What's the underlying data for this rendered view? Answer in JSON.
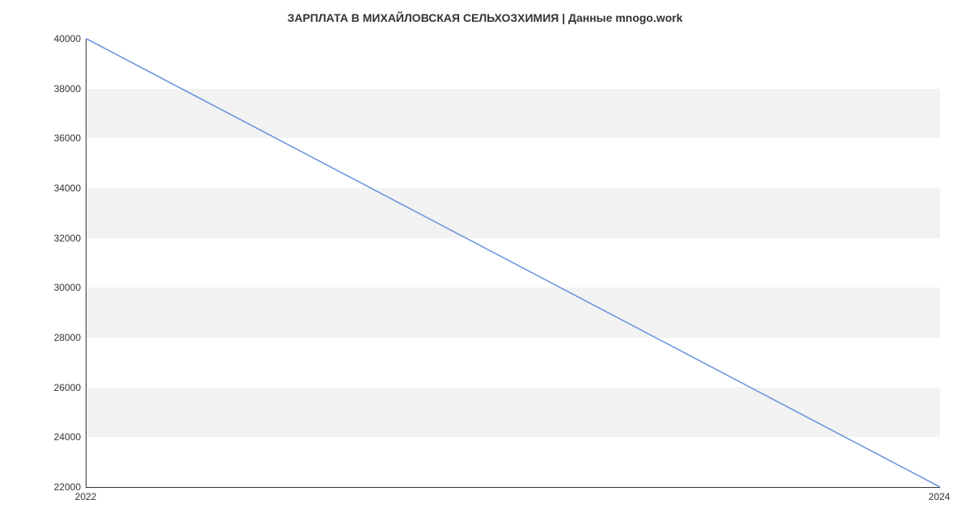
{
  "chart_data": {
    "type": "line",
    "title": "ЗАРПЛАТА В  МИХАЙЛОВСКАЯ СЕЛЬХОЗХИМИЯ | Данные mnogo.work",
    "x": [
      2022,
      2024
    ],
    "values": [
      40000,
      22000
    ],
    "xlabel": "",
    "ylabel": "",
    "x_ticks": [
      2022,
      2024
    ],
    "y_ticks": [
      22000,
      24000,
      26000,
      28000,
      30000,
      32000,
      34000,
      36000,
      38000,
      40000
    ],
    "xlim": [
      2022,
      2024
    ],
    "ylim": [
      22000,
      40000
    ],
    "line_color": "#6b95de",
    "band_color": "#f2f2f2"
  }
}
